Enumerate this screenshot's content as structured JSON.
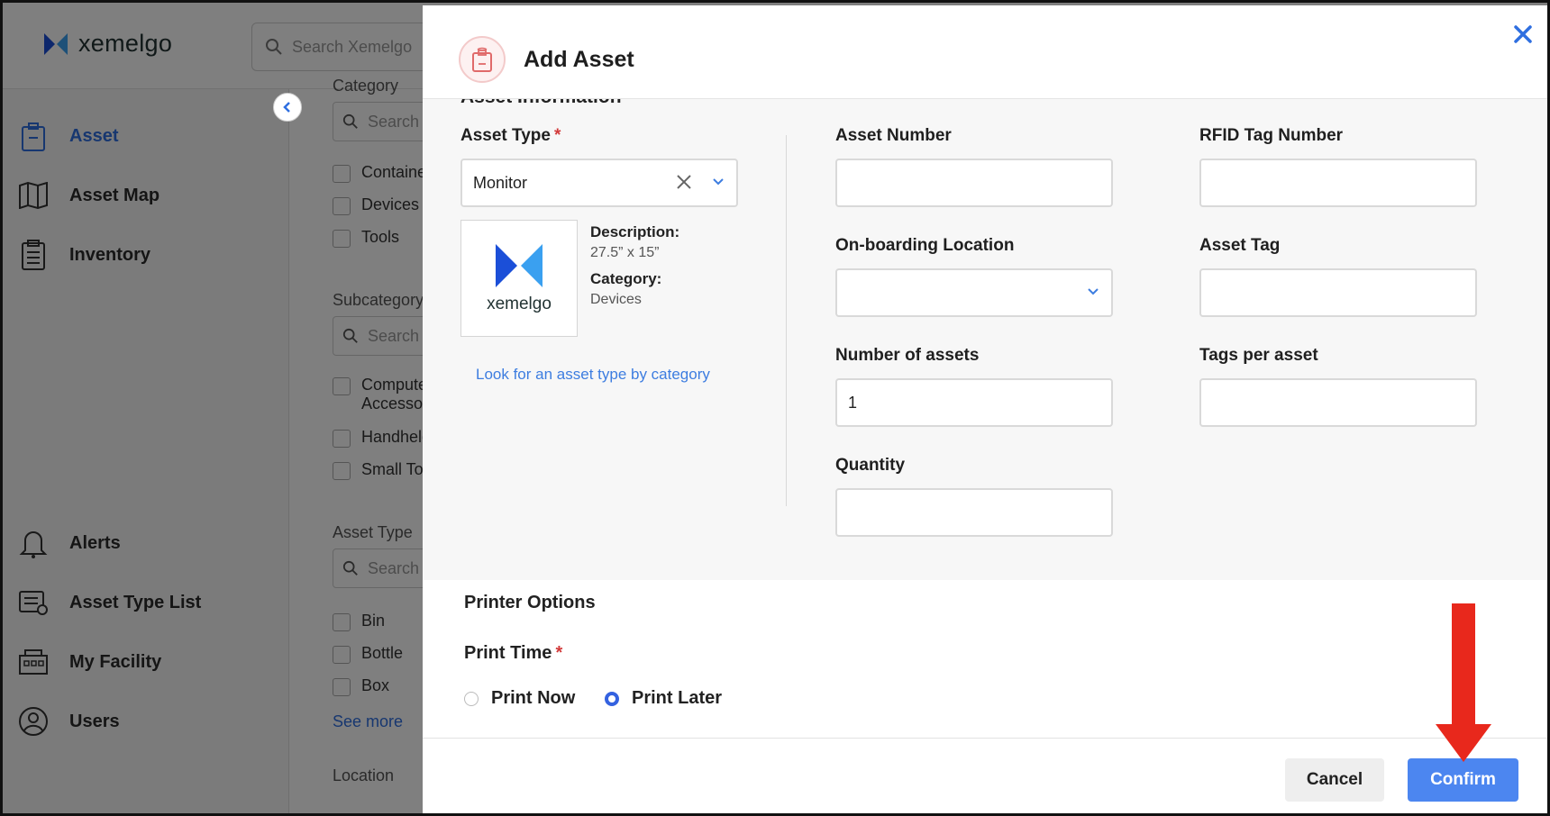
{
  "app": {
    "logo_text": "xemelgo",
    "search_placeholder": "Search Xemelgo",
    "sidebar": {
      "items": [
        {
          "label": "Asset",
          "icon": "asset-tag-icon",
          "active": true
        },
        {
          "label": "Asset Map",
          "icon": "map-icon"
        },
        {
          "label": "Inventory",
          "icon": "clipboard-icon"
        },
        {
          "label": "Alerts",
          "icon": "bell-icon"
        },
        {
          "label": "Asset Type List",
          "icon": "list-settings-icon"
        },
        {
          "label": "My Facility",
          "icon": "building-icon"
        },
        {
          "label": "Users",
          "icon": "user-icon"
        }
      ]
    },
    "filters": {
      "category_title": "Category",
      "subcategory_title": "Subcategory",
      "asset_type_title": "Asset Type",
      "location_title": "Location",
      "search_placeholder": "Search",
      "category_options": [
        "Containers",
        "Devices",
        "Tools"
      ],
      "subcategory_options": [
        "Computer",
        "Accessories",
        "Handheld",
        "Small Tools"
      ],
      "asset_type_options": [
        "Bin",
        "Bottle",
        "Box"
      ],
      "see_more": "See more"
    }
  },
  "modal": {
    "title": "Add Asset",
    "section_title": "Asset Information",
    "asset_type": {
      "label": "Asset Type",
      "required_mark": "*",
      "value": "Monitor",
      "thumbnail_text": "xemelgo",
      "description_label": "Description:",
      "description_value": "27.5” x 15”",
      "category_label": "Category:",
      "category_value": "Devices",
      "lookup_link": "Look for an asset type by category"
    },
    "fields": {
      "asset_number": {
        "label": "Asset Number",
        "value": ""
      },
      "rfid_tag_number": {
        "label": "RFID Tag Number",
        "value": ""
      },
      "onboarding_location": {
        "label": "On-boarding Location",
        "value": ""
      },
      "asset_tag": {
        "label": "Asset Tag",
        "value": ""
      },
      "number_of_assets": {
        "label": "Number of assets",
        "value": "1"
      },
      "tags_per_asset": {
        "label": "Tags per asset",
        "value": ""
      },
      "quantity": {
        "label": "Quantity",
        "value": ""
      }
    },
    "printer": {
      "title": "Printer Options",
      "print_time_label": "Print Time",
      "required_mark": "*",
      "options": [
        {
          "label": "Print Now",
          "selected": false
        },
        {
          "label": "Print Later",
          "selected": true
        }
      ]
    },
    "buttons": {
      "cancel": "Cancel",
      "confirm": "Confirm"
    }
  },
  "colors": {
    "accent_blue": "#4c86f0",
    "link_blue": "#3d7de0",
    "required_red": "#d23a3a",
    "annotation_arrow": "#e8281c"
  }
}
